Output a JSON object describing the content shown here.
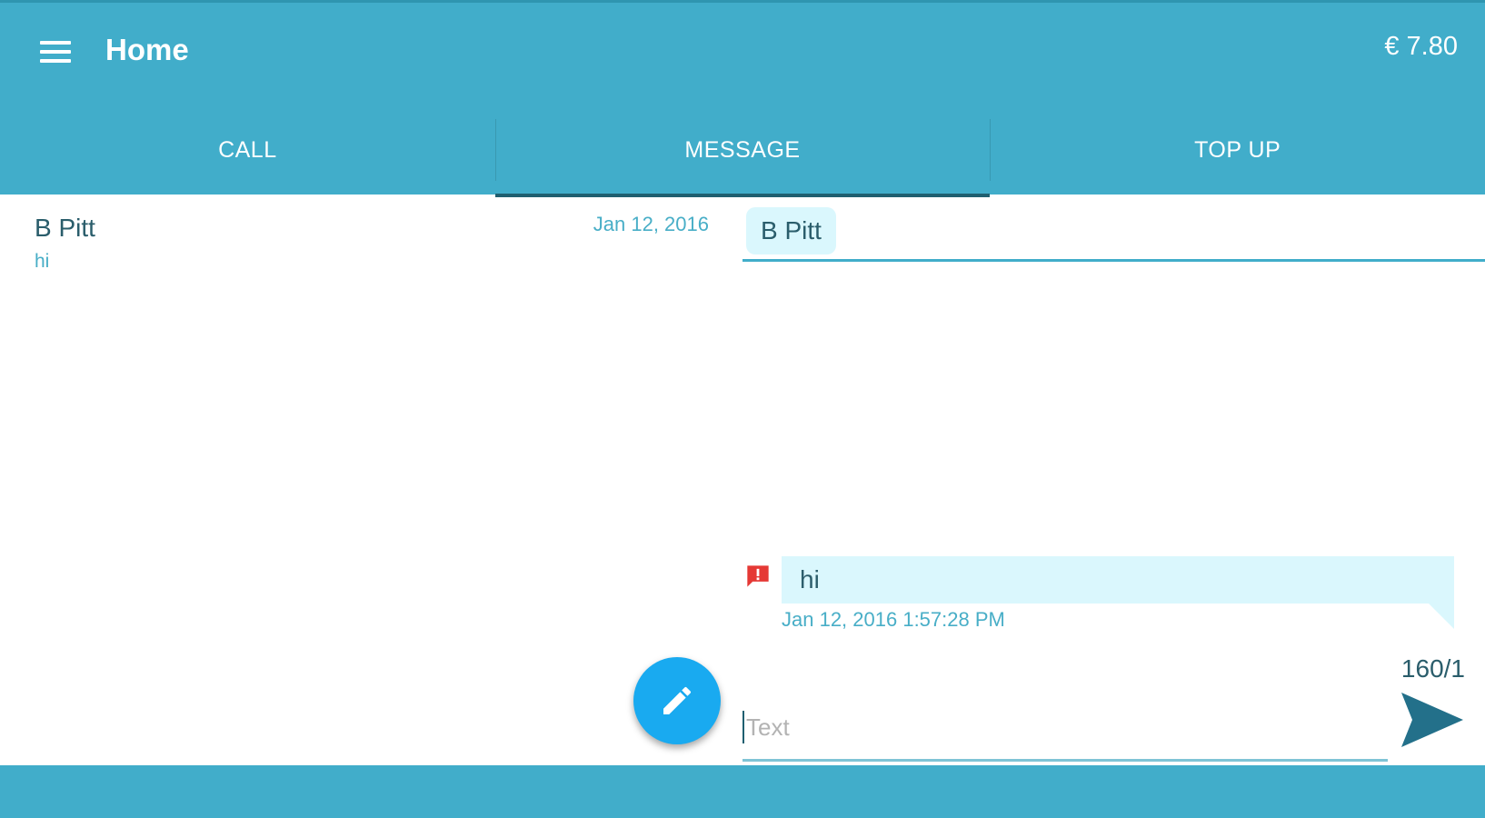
{
  "app": {
    "title": "Home",
    "balance": "€ 7.80"
  },
  "colors": {
    "primary": "#41adca",
    "accent_fab": "#19aaf0",
    "bubble": "#daf7fd",
    "error": "#e53935"
  },
  "icons": {
    "menu": "hamburger-menu-icon",
    "fab": "pencil-icon",
    "error": "error-alert-icon",
    "send": "send-icon"
  },
  "tabs": [
    {
      "label": "CALL",
      "active": false
    },
    {
      "label": "MESSAGE",
      "active": true
    },
    {
      "label": "TOP UP",
      "active": false
    }
  ],
  "conversations": [
    {
      "name": "B Pitt",
      "date": "Jan 12, 2016",
      "preview": "hi"
    }
  ],
  "thread": {
    "recipient": "B Pitt",
    "messages": [
      {
        "text": "hi",
        "timestamp": "Jan 12, 2016 1:57:28 PM",
        "status": "error"
      }
    ]
  },
  "compose": {
    "placeholder": "Text",
    "value": "",
    "counter": "160/1"
  }
}
